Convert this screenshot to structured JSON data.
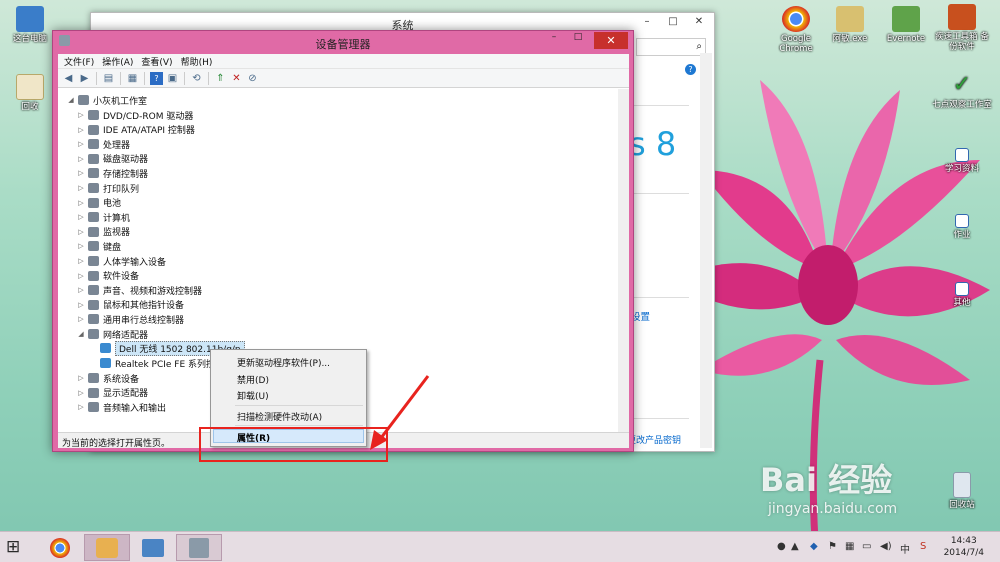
{
  "desktop_icons_left": [
    {
      "label": "这台电脑",
      "icon": "computer-icon"
    },
    {
      "label": "回收",
      "icon": "recycle-bin-icon"
    }
  ],
  "desktop_icons_right": [
    {
      "label": "Google Chrome",
      "icon": "chrome-icon"
    },
    {
      "label": "阿敏.exe",
      "icon": "app-icon"
    },
    {
      "label": "Evernote",
      "icon": "evernote-icon"
    },
    {
      "label": "疾速工具箱 备份软件",
      "icon": "toolbox-icon"
    },
    {
      "label": "七点观察工作室",
      "icon": "check-icon"
    },
    {
      "label": "学习资料",
      "icon": "shortcut-icon"
    },
    {
      "label": "作业",
      "icon": "shortcut-icon"
    },
    {
      "label": "其他",
      "icon": "shortcut-icon"
    },
    {
      "label": "回收站",
      "icon": "recycle-bin-icon"
    }
  ],
  "system_window": {
    "title": "系统",
    "brand": "s 8",
    "link_settings": "设置",
    "link_key": "更改产品密钥"
  },
  "device_manager": {
    "title": "设备管理器",
    "menu": [
      "文件(F)",
      "操作(A)",
      "查看(V)",
      "帮助(H)"
    ],
    "root": "小灰机工作室",
    "categories": [
      "DVD/CD-ROM 驱动器",
      "IDE ATA/ATAPI 控制器",
      "处理器",
      "磁盘驱动器",
      "存储控制器",
      "打印队列",
      "电池",
      "计算机",
      "监视器",
      "键盘",
      "人体学输入设备",
      "软件设备",
      "声音、视频和游戏控制器",
      "鼠标和其他指针设备",
      "通用串行总线控制器",
      "网络适配器"
    ],
    "network_children": [
      "Dell 无线 1502 802.11b/g/n",
      "Realtek PCIe FE 系列控制器"
    ],
    "categories_after": [
      "系统设备",
      "显示适配器",
      "音频输入和输出"
    ],
    "status": "为当前的选择打开属性页。"
  },
  "context_menu": {
    "items": [
      "更新驱动程序软件(P)...",
      "禁用(D)",
      "卸载(U)",
      "扫描检测硬件改动(A)"
    ],
    "selected": "属性(R)"
  },
  "watermark": {
    "main": "Bai 经验",
    "url": "jingyan.baidu.com"
  },
  "taskbar": {
    "clock_time": "14:43",
    "clock_date": "2014/7/4",
    "ime": "中",
    "apps": [
      "chrome-icon",
      "people-icon",
      "remote-desktop-icon",
      "device-manager-icon"
    ]
  },
  "colors": {
    "titlebar": "#e06aa6",
    "close": "#c7302c",
    "annotation": "#e8231e",
    "selection": "#cde6f7"
  }
}
